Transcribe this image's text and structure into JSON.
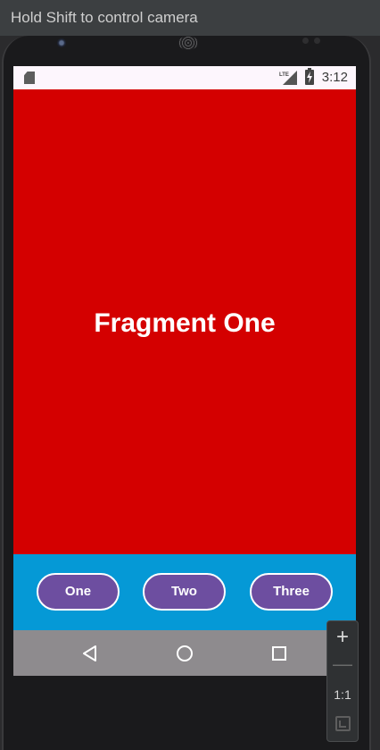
{
  "emulator": {
    "hint": "Hold Shift to control camera",
    "zoom": {
      "zoom_in": "+",
      "zoom_out": "—",
      "actual_size": "1:1"
    }
  },
  "status_bar": {
    "time": "3:12",
    "network_label": "LTE",
    "icons": [
      "sd-card-icon",
      "lte-signal-icon",
      "battery-charging-icon"
    ]
  },
  "fragment": {
    "title": "Fragment One",
    "background": "#d40000"
  },
  "buttons": [
    {
      "label": "One"
    },
    {
      "label": "Two"
    },
    {
      "label": "Three"
    }
  ],
  "colors": {
    "button_bar": "#0599d6",
    "button_fill": "#6d4ea0",
    "nav_bar": "#8e8b8e"
  },
  "nav": {
    "icons": [
      "back-icon",
      "home-icon",
      "recents-icon"
    ]
  }
}
